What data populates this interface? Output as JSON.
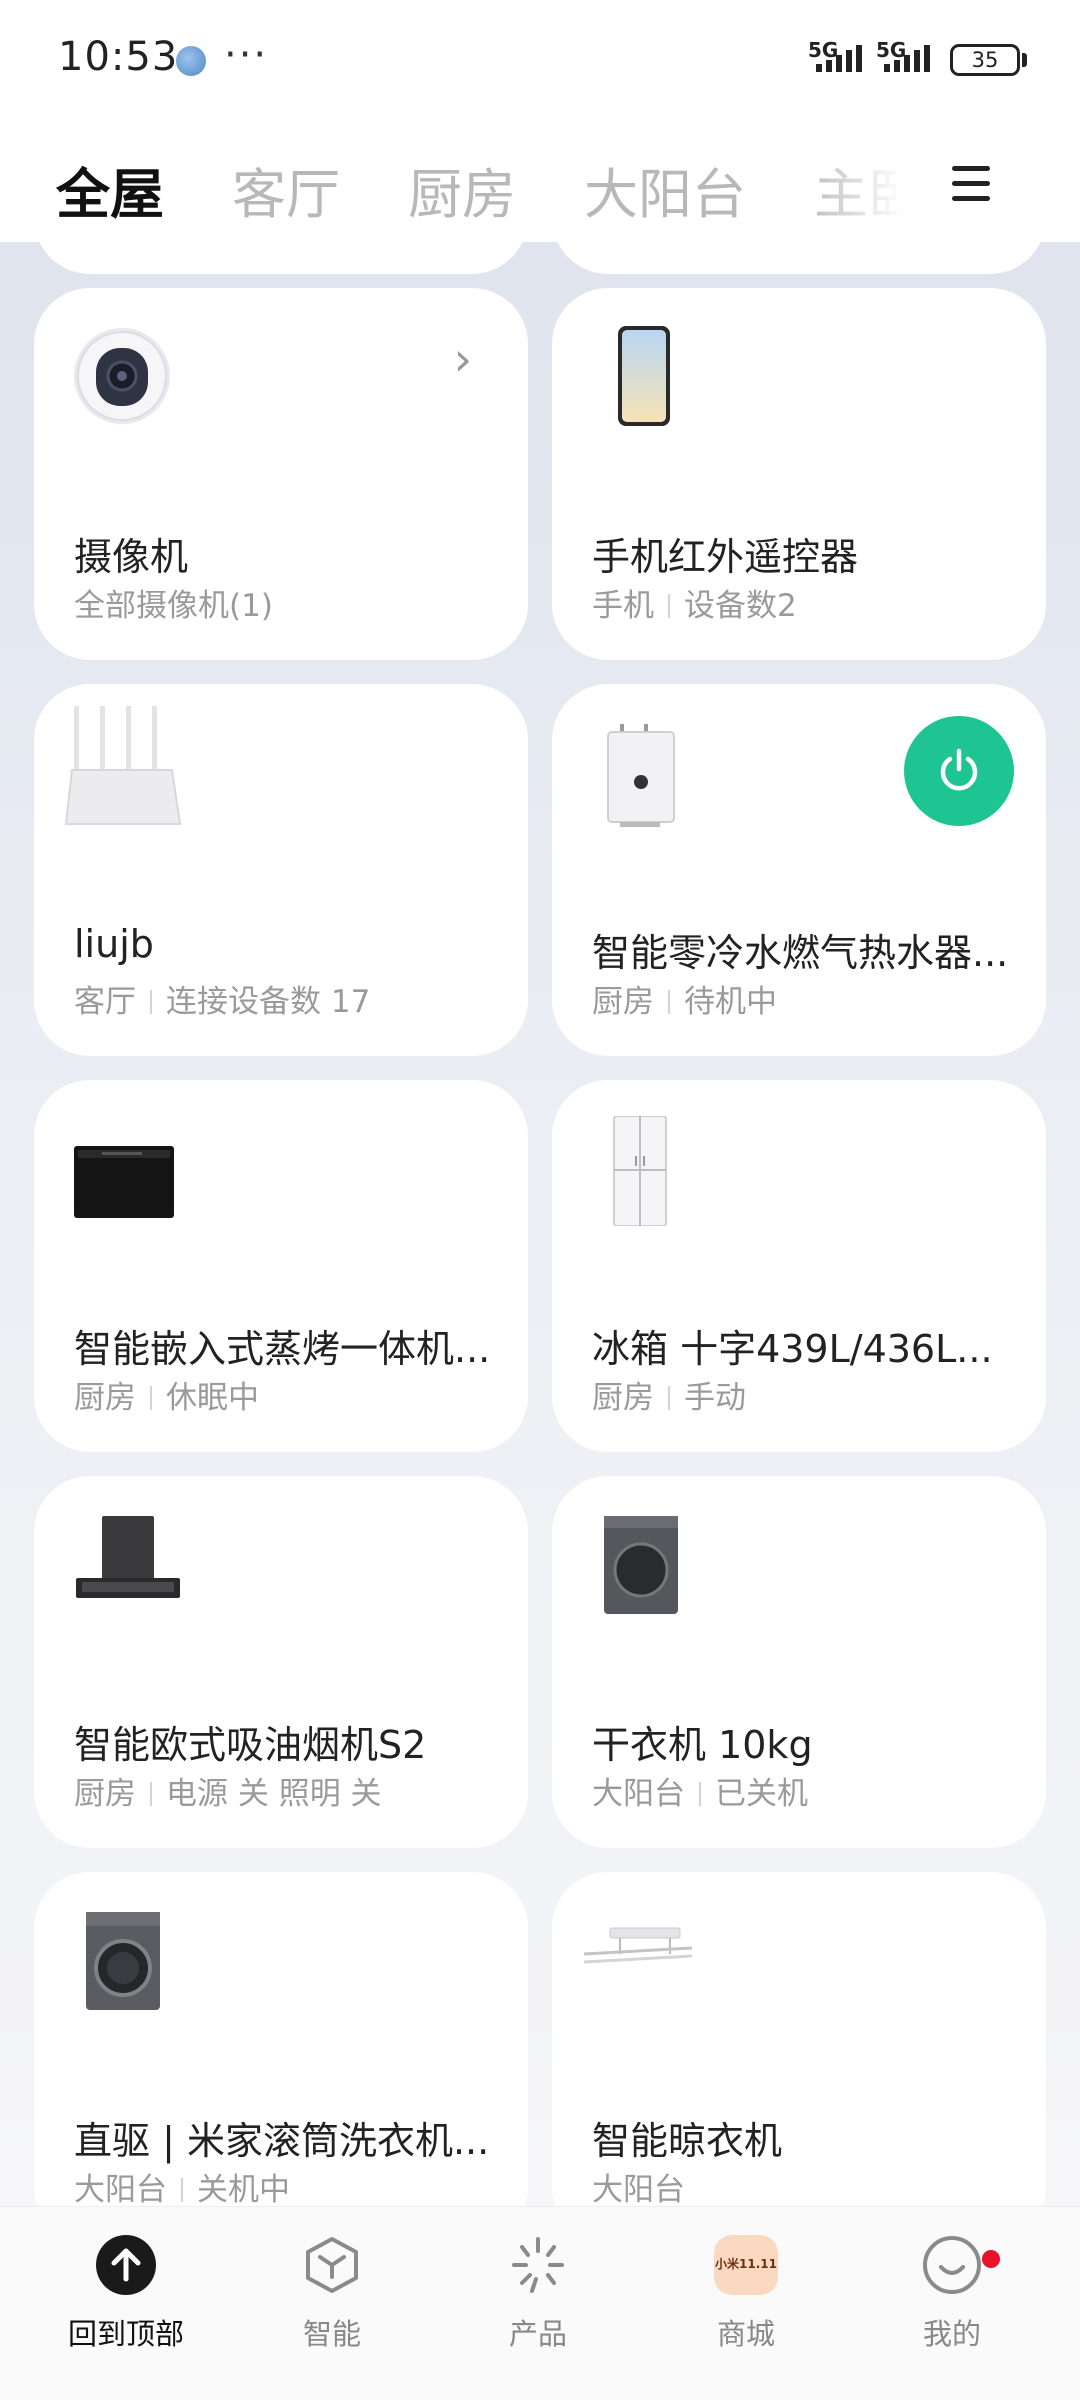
{
  "status_bar": {
    "time": "10:53",
    "more": "···",
    "sim1_label": "5G",
    "sim2_label": "5G",
    "battery": "35"
  },
  "tabs": [
    {
      "label": "全屋",
      "active": true
    },
    {
      "label": "客厅",
      "active": false
    },
    {
      "label": "厨房",
      "active": false
    },
    {
      "label": "大阳台",
      "active": false
    },
    {
      "label": "主卧",
      "active": false
    }
  ],
  "devices": [
    {
      "name": "摄像机",
      "room": "",
      "status": "全部摄像机(1)",
      "icon": "camera-icon",
      "has_chevron": true
    },
    {
      "name": "手机红外遥控器",
      "room": "手机",
      "status": "设备数2",
      "icon": "phone-icon"
    },
    {
      "name": "liujb",
      "room": "客厅",
      "status": "连接设备数 17",
      "icon": "router-icon"
    },
    {
      "name": "智能零冷水燃气热水器...",
      "room": "厨房",
      "status": "待机中",
      "icon": "water-heater-icon",
      "power_on": true
    },
    {
      "name": "智能嵌入式蒸烤一体机...",
      "room": "厨房",
      "status": "休眠中",
      "icon": "oven-icon"
    },
    {
      "name": "冰箱 十字439L/436L...",
      "room": "厨房",
      "status": "手动",
      "icon": "fridge-icon"
    },
    {
      "name": "智能欧式吸油烟机S2",
      "room": "厨房",
      "status": "电源 关 照明 关",
      "icon": "range-hood-icon"
    },
    {
      "name": "干衣机 10kg",
      "room": "大阳台",
      "status": "已关机",
      "icon": "dryer-icon"
    },
    {
      "name": "直驱 | 米家滚筒洗衣机...",
      "room": "大阳台",
      "status": "关机中",
      "icon": "washer-icon"
    },
    {
      "name": "智能晾衣机",
      "room": "大阳台",
      "status": "",
      "icon": "clothes-rack-icon"
    }
  ],
  "bottom_nav": [
    {
      "label": "回到顶部",
      "icon": "arrow-up-icon",
      "active": true
    },
    {
      "label": "智能",
      "icon": "smart-cube-icon"
    },
    {
      "label": "产品",
      "icon": "product-spark-icon"
    },
    {
      "label": "商城",
      "icon": "mall-icon",
      "badge_text": "小米11.11"
    },
    {
      "label": "我的",
      "icon": "profile-icon",
      "has_dot": true
    }
  ],
  "colors": {
    "power_on": "#1ec592",
    "badge_dot": "#e8122c"
  }
}
